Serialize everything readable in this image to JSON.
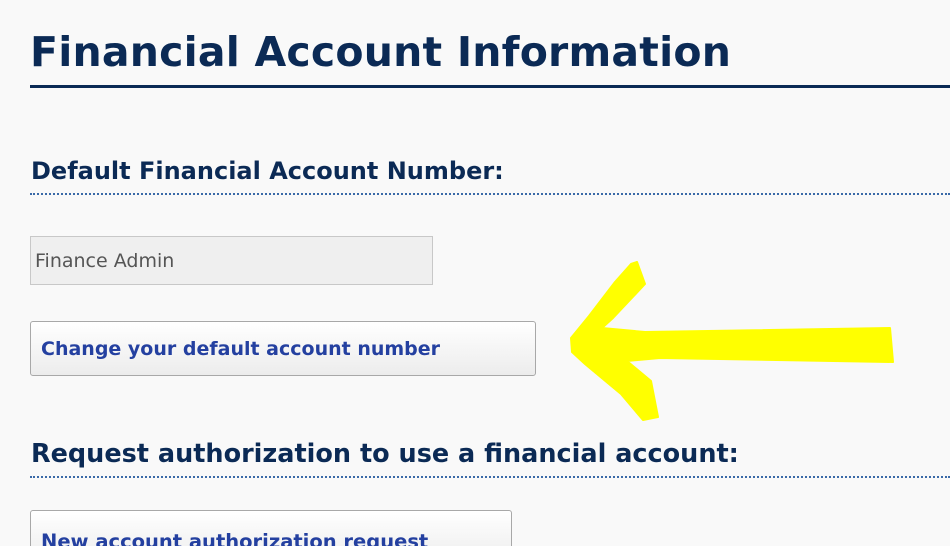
{
  "page": {
    "title": "Financial Account Information"
  },
  "default_account": {
    "heading": "Default Financial Account Number:",
    "field_value": "Finance Admin",
    "change_button_label": "Change your default account number"
  },
  "authorization": {
    "heading": "Request authorization to use a financial account:",
    "new_request_button_label": "New account authorization request"
  },
  "annotation": {
    "arrow_icon": "arrow-left-icon",
    "arrow_color": "#ffff00"
  },
  "colors": {
    "heading": "#0b2a55",
    "button_text": "#2440a0",
    "background": "#f9f9f9"
  }
}
